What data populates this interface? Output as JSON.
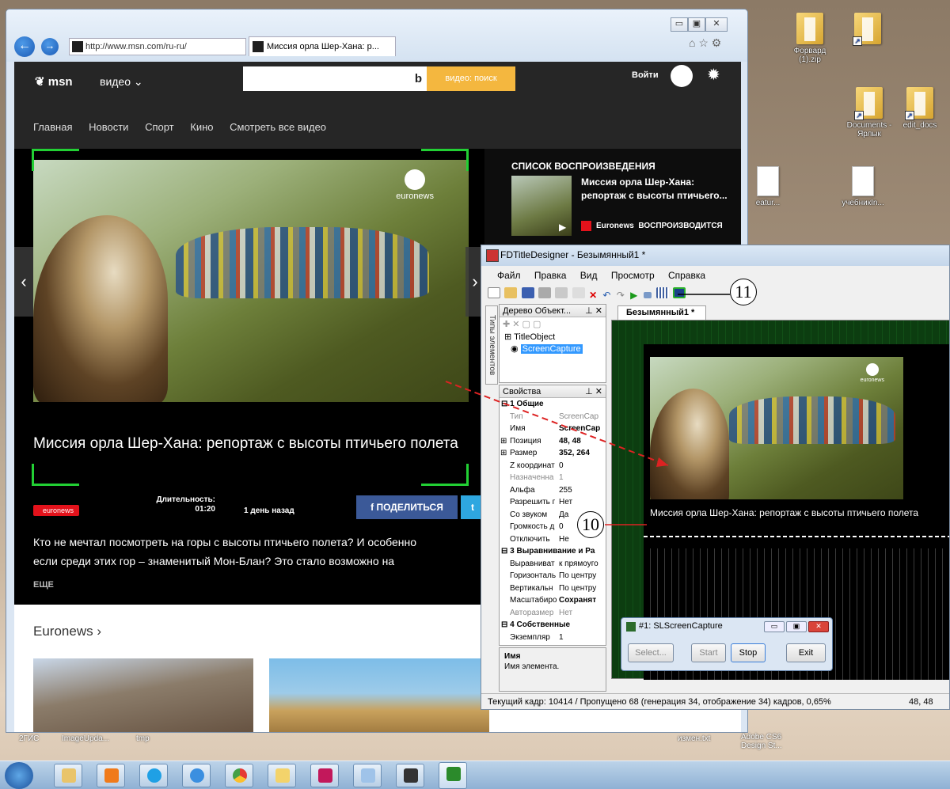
{
  "desktop": {
    "icons": [
      {
        "label": "Форвард\n(1).zip"
      },
      {
        "label": ""
      },
      {
        "label": "Documents -\nЯрлык"
      },
      {
        "label": "edit_docs"
      },
      {
        "label": "eatur..."
      },
      {
        "label": "учебникIn..."
      }
    ],
    "bottom_labels": [
      "2ГИС",
      "ImageUpda...",
      "tmp",
      "измен.txt",
      "Adobe CS6\nDesign St..."
    ]
  },
  "browser": {
    "address": "http://www.msn.com/ru-ru/",
    "tab_title": "Миссия орла Шер-Хана: р...",
    "window_controls": [
      "▭",
      "▣",
      "✕"
    ]
  },
  "msn": {
    "logo": "msn",
    "section": "видео ⌄",
    "search_button": "видео: поиск",
    "search_value": "",
    "sign_in": "Войти",
    "nav": [
      "Главная",
      "Новости",
      "Спорт",
      "Кино",
      "Смотреть все видео"
    ],
    "video": {
      "brand": "euronews",
      "title": "Миссия орла Шер-Хана: репортаж с высоты птичьего полета",
      "duration_label": "Длительность:",
      "duration": "01:20",
      "published": "1 день назад",
      "source": "euronews",
      "share_label": "ПОДЕЛИТЬСЯ",
      "description_line1": "Кто не мечтал посмотреть на горы с высоты птичьего полета? И особенно",
      "description_line2": "если среди этих гор – знаменитый Мон-Блан? Это стало возможно на",
      "more": "ЕЩЕ"
    },
    "playlist": {
      "heading": "СПИСОК ВОСПРОИЗВЕДЕНИЯ",
      "item_title": "Миссия орла Шер-Хана: репортаж с высоты птичьего...",
      "item_source": "Euronews",
      "item_status": "ВОСПРОИЗВОДИТСЯ"
    },
    "section_heading": "Euronews ›"
  },
  "fd": {
    "title": "FDTitleDesigner - Безымянный1 *",
    "menu": [
      "Файл",
      "Правка",
      "Вид",
      "Просмотр",
      "Справка"
    ],
    "tree_panel_title": "Дерево Объект...",
    "tree_items": [
      "TitleObject",
      "ScreenCapture"
    ],
    "vertical_tab": "Типы элементов",
    "props_title": "Свойства",
    "properties": [
      {
        "k": "1 Общие",
        "v": "",
        "type": "grp"
      },
      {
        "k": "Тип",
        "v": "ScreenCap",
        "type": "gray"
      },
      {
        "k": "Имя",
        "v": "ScreenCap",
        "type": "bold"
      },
      {
        "k": "Позиция",
        "v": "48, 48",
        "type": "bold"
      },
      {
        "k": "Размер",
        "v": "352, 264",
        "type": "bold"
      },
      {
        "k": "Z координат",
        "v": "0",
        "type": ""
      },
      {
        "k": "Назначенна",
        "v": "1",
        "type": "gray"
      },
      {
        "k": "Альфа",
        "v": "255",
        "type": ""
      },
      {
        "k": "Разрешить г",
        "v": "Нет",
        "type": ""
      },
      {
        "k": "Со звуком",
        "v": "Да",
        "type": ""
      },
      {
        "k": "Громкость д",
        "v": "0",
        "type": ""
      },
      {
        "k": "Отключить",
        "v": "Не",
        "type": ""
      },
      {
        "k": "3 Выравнивание и Ра",
        "v": "",
        "type": "grp"
      },
      {
        "k": "Выравниват",
        "v": "к прямоуго",
        "type": ""
      },
      {
        "k": "Горизонталь",
        "v": "По центру",
        "type": ""
      },
      {
        "k": "Вертикальн",
        "v": "По центру",
        "type": ""
      },
      {
        "k": "Масштабиро",
        "v": "Сохранят",
        "type": "bold"
      },
      {
        "k": "Авторазмер",
        "v": "Нет",
        "type": "gray"
      },
      {
        "k": "4 Собственные",
        "v": "",
        "type": "grp"
      },
      {
        "k": "Экземпляр",
        "v": "1",
        "type": ""
      }
    ],
    "help_title": "Имя",
    "help_text": "Имя элемента.",
    "doc_tab": "Безымянный1 *",
    "capture_title": "Миссия орла Шер-Хана: репортаж с высоты птичьего полета",
    "capture_brand": "euronews",
    "status": "Текущий кадр: 10414 / Пропущено 68 (генерация 34, отображение 34) кадров,  0,65%",
    "status_pos": "48, 48"
  },
  "slcap": {
    "title": "#1: SLScreenCapture",
    "buttons": [
      "Select...",
      "Start",
      "Stop",
      "Exit"
    ]
  },
  "callouts": [
    "10",
    "11"
  ]
}
